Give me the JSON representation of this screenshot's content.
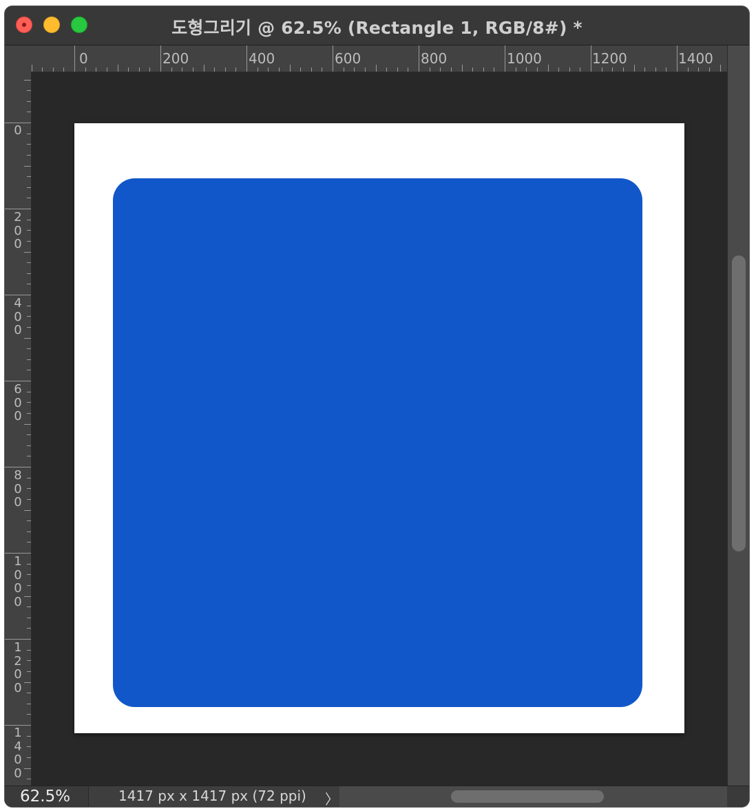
{
  "window": {
    "title": "도형그리기 @ 62.5% (Rectangle 1, RGB/8#) *"
  },
  "rulers": {
    "horizontal_labels": [
      "0",
      "200",
      "400",
      "600",
      "800",
      "1000",
      "1200",
      "1400"
    ],
    "vertical_labels": [
      "0",
      "200",
      "400",
      "600",
      "800",
      "1000",
      "1200",
      "1400"
    ]
  },
  "canvas": {
    "background_color": "#ffffff",
    "shape": {
      "name": "Rectangle 1",
      "type": "rounded-rectangle",
      "fill_color": "#1257c9"
    }
  },
  "statusbar": {
    "zoom": "62.5%",
    "document_info": "1417 px x 1417 px (72 ppi)",
    "arrow": "〉"
  },
  "colors": {
    "traffic_close": "#ff5f57",
    "traffic_minimize": "#febc2e",
    "traffic_maximize": "#28c840",
    "pasteboard": "#282828"
  }
}
